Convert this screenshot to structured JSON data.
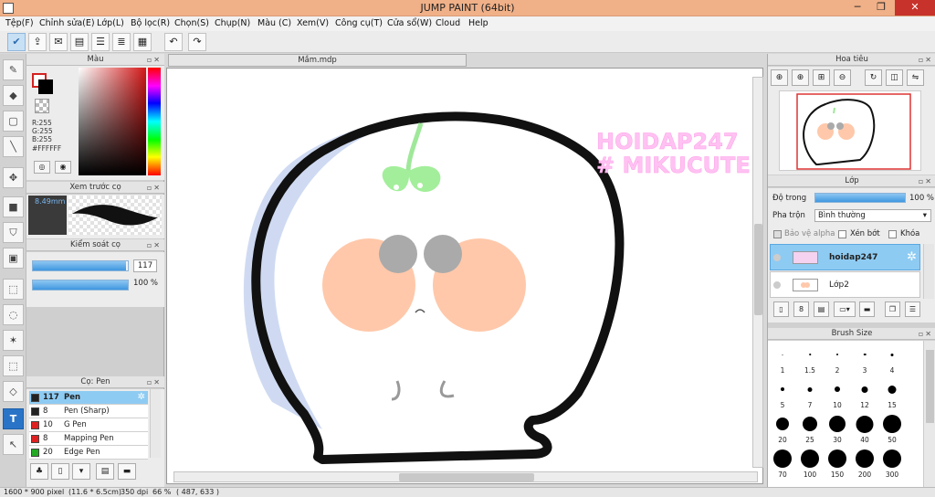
{
  "window": {
    "title": "JUMP PAINT (64bit)"
  },
  "menu": [
    "Tệp(F)",
    "Chỉnh sửa(E)",
    "Lớp(L)",
    "Bộ lọc(R)",
    "Chọn(S)",
    "Chụp(N)",
    "Màu (C)",
    "Xem(V)",
    "Công cụ(T)",
    "Cửa sổ(W)",
    "Cloud",
    "Help"
  ],
  "color_panel": {
    "title": "Màu",
    "r": "R:255",
    "g": "G:255",
    "b": "B:255",
    "hex": "#FFFFFF",
    "fg": "#ffffff",
    "bg": "#000000"
  },
  "preview_panel": {
    "title": "Xem trước cọ",
    "size": "8.49mm"
  },
  "control_panel": {
    "title": "Kiểm soát cọ",
    "size": "117",
    "size_fraction": 0.98,
    "opacity": "100 %",
    "opacity_fraction": 1.0
  },
  "brush_panel": {
    "title": "Cọ: Pen",
    "items": [
      {
        "size": "117",
        "name": "Pen",
        "color": "#222222"
      },
      {
        "size": "8",
        "name": "Pen (Sharp)",
        "color": "#222222"
      },
      {
        "size": "10",
        "name": "G Pen",
        "color": "#e02020"
      },
      {
        "size": "8",
        "name": "Mapping Pen",
        "color": "#e02020"
      },
      {
        "size": "20",
        "name": "Edge Pen",
        "color": "#22aa22"
      }
    ]
  },
  "canvas": {
    "tab": "Mầm.mdp",
    "watermark_line1": "HOIDAP247",
    "watermark_line2": "# MIKUCUTE"
  },
  "navigator": {
    "title": "Hoa tiêu"
  },
  "layer_panel": {
    "title": "Lớp",
    "opacity_label": "Độ trong",
    "opacity": "100 %",
    "blend_label": "Pha trộn",
    "blend": "Bình thường",
    "protect_alpha": "Bảo vệ alpha",
    "clip": "Xén bớt",
    "lock": "Khóa",
    "layers": [
      "hoidap247",
      "Lớp2"
    ]
  },
  "brush_size": {
    "title": "Brush Size",
    "sizes": [
      {
        "label": "1",
        "d": 1
      },
      {
        "label": "1.5",
        "d": 1.5
      },
      {
        "label": "2",
        "d": 2
      },
      {
        "label": "3",
        "d": 2.5
      },
      {
        "label": "4",
        "d": 3
      },
      {
        "label": "5",
        "d": 4
      },
      {
        "label": "7",
        "d": 5
      },
      {
        "label": "10",
        "d": 6
      },
      {
        "label": "12",
        "d": 7
      },
      {
        "label": "15",
        "d": 9
      },
      {
        "label": "20",
        "d": 14
      },
      {
        "label": "25",
        "d": 16
      },
      {
        "label": "30",
        "d": 18
      },
      {
        "label": "40",
        "d": 19
      },
      {
        "label": "50",
        "d": 20
      },
      {
        "label": "70",
        "d": 20
      },
      {
        "label": "100",
        "d": 20
      },
      {
        "label": "150",
        "d": 20
      },
      {
        "label": "200",
        "d": 20
      },
      {
        "label": "300",
        "d": 20
      }
    ]
  },
  "status": {
    "pixels": "1600 * 900 pixel",
    "cm": "(11.6 * 6.5cm)",
    "dpi": "350 dpi",
    "zoom": "66 %",
    "coords": "( 487, 633 )"
  }
}
